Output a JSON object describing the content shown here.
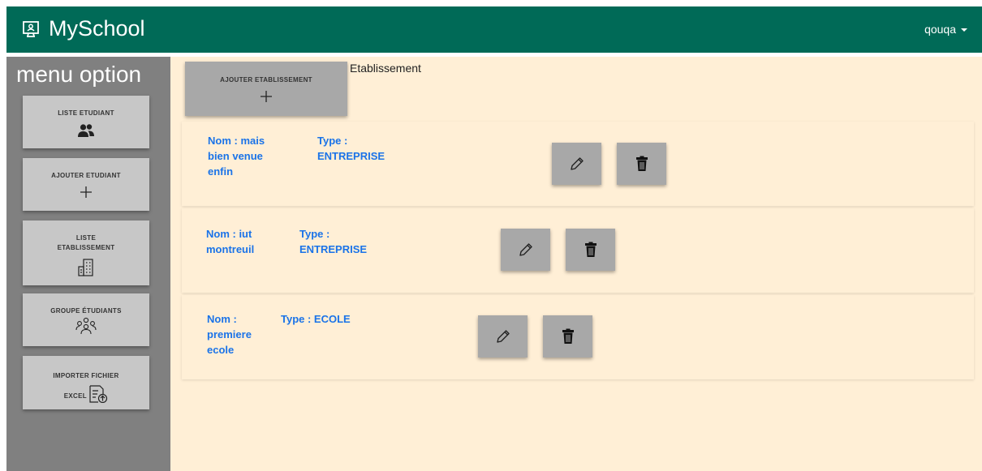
{
  "navbar": {
    "brand": "MySchool",
    "user": "qouqa"
  },
  "sidebar": {
    "title": "menu option",
    "items": [
      {
        "label": "LISTE ETUDIANT",
        "icon": "users-icon"
      },
      {
        "label": "AJOUTER ETUDIANT",
        "icon": "plus-icon"
      },
      {
        "label": "LISTE ETABLISSEMENT",
        "icon": "building-icon"
      },
      {
        "label": "GROUPE ÉTUDIANTS",
        "icon": "group-icon"
      },
      {
        "label": "IMPORTER FICHIER EXCEL",
        "icon": "file-upload-icon"
      }
    ]
  },
  "main": {
    "add_button": {
      "label": "AJOUTER ETABLISSEMENT",
      "icon": "plus-icon"
    },
    "title": "Etablissement",
    "establishments": [
      {
        "name": "Nom : mais bien venue enfin",
        "type": "Type : ENTREPRISE"
      },
      {
        "name": "Nom : iut montreuil",
        "type": "Type : ENTREPRISE"
      },
      {
        "name": "Nom : premiere ecole",
        "type": "Type : ECOLE"
      }
    ],
    "edit_icon": "pencil-icon",
    "delete_icon": "trash-icon"
  },
  "colors": {
    "navbar": "#006a57",
    "sidebar": "#808080",
    "content": "#ffefd6",
    "accent_text": "#1a73e8"
  }
}
